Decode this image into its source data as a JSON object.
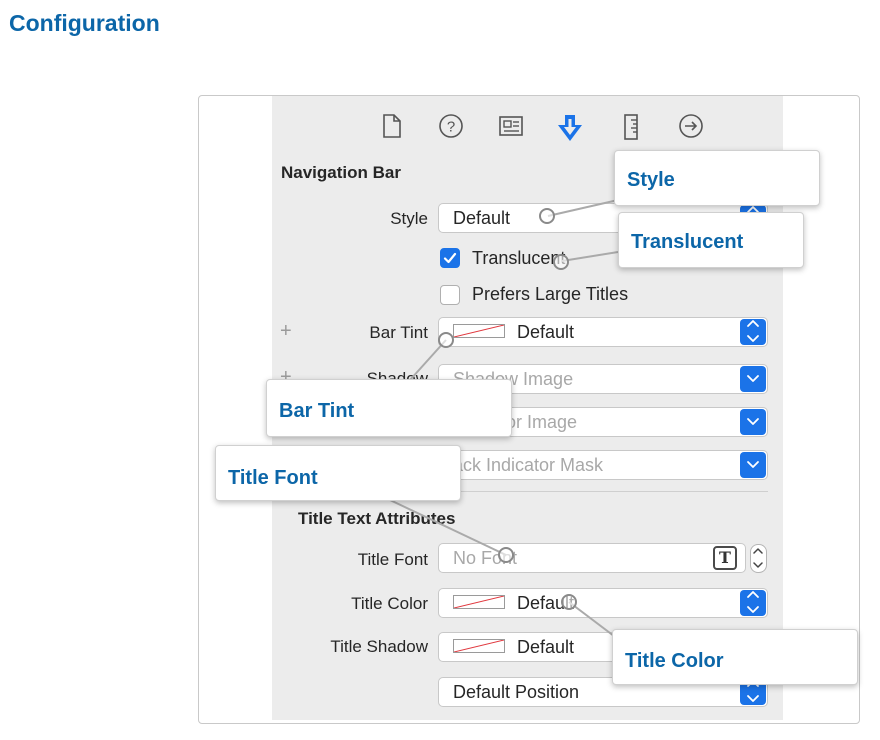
{
  "heading": "Configuration",
  "toolbar_icons": [
    "file-icon",
    "help-icon",
    "identity-icon",
    "attributes-icon",
    "size-icon",
    "connections-icon"
  ],
  "navigation_bar": {
    "section_title": "Navigation Bar",
    "style_label": "Style",
    "style_value": "Default",
    "translucent_label": "Translucent",
    "translucent_checked": true,
    "large_titles_label": "Prefers Large Titles",
    "large_titles_checked": false,
    "bar_tint_label": "Bar Tint",
    "bar_tint_value": "Default",
    "shadow_label": "Shadow",
    "shadow_placeholder": "Shadow Image",
    "back_indicator_placeholder": "Indicator Image",
    "back_mask_placeholder": "ack Indicator Mask"
  },
  "title_text_attributes": {
    "section_title": "Title Text Attributes",
    "title_font_label": "Title Font",
    "title_font_placeholder": "No Font",
    "title_color_label": "Title Color",
    "title_color_value": "Default",
    "title_shadow_label": "Title Shadow",
    "title_shadow_value": "Default",
    "shadow_offset_value": "Default Position"
  },
  "callouts": {
    "style": "Style",
    "translucent": "Translucent",
    "bar_tint": "Bar Tint",
    "title_font": "Title Font",
    "title_color": "Title Color"
  },
  "colors": {
    "accent": "#1b73e8",
    "heading": "#0c66a8",
    "panel": "#ececec"
  }
}
